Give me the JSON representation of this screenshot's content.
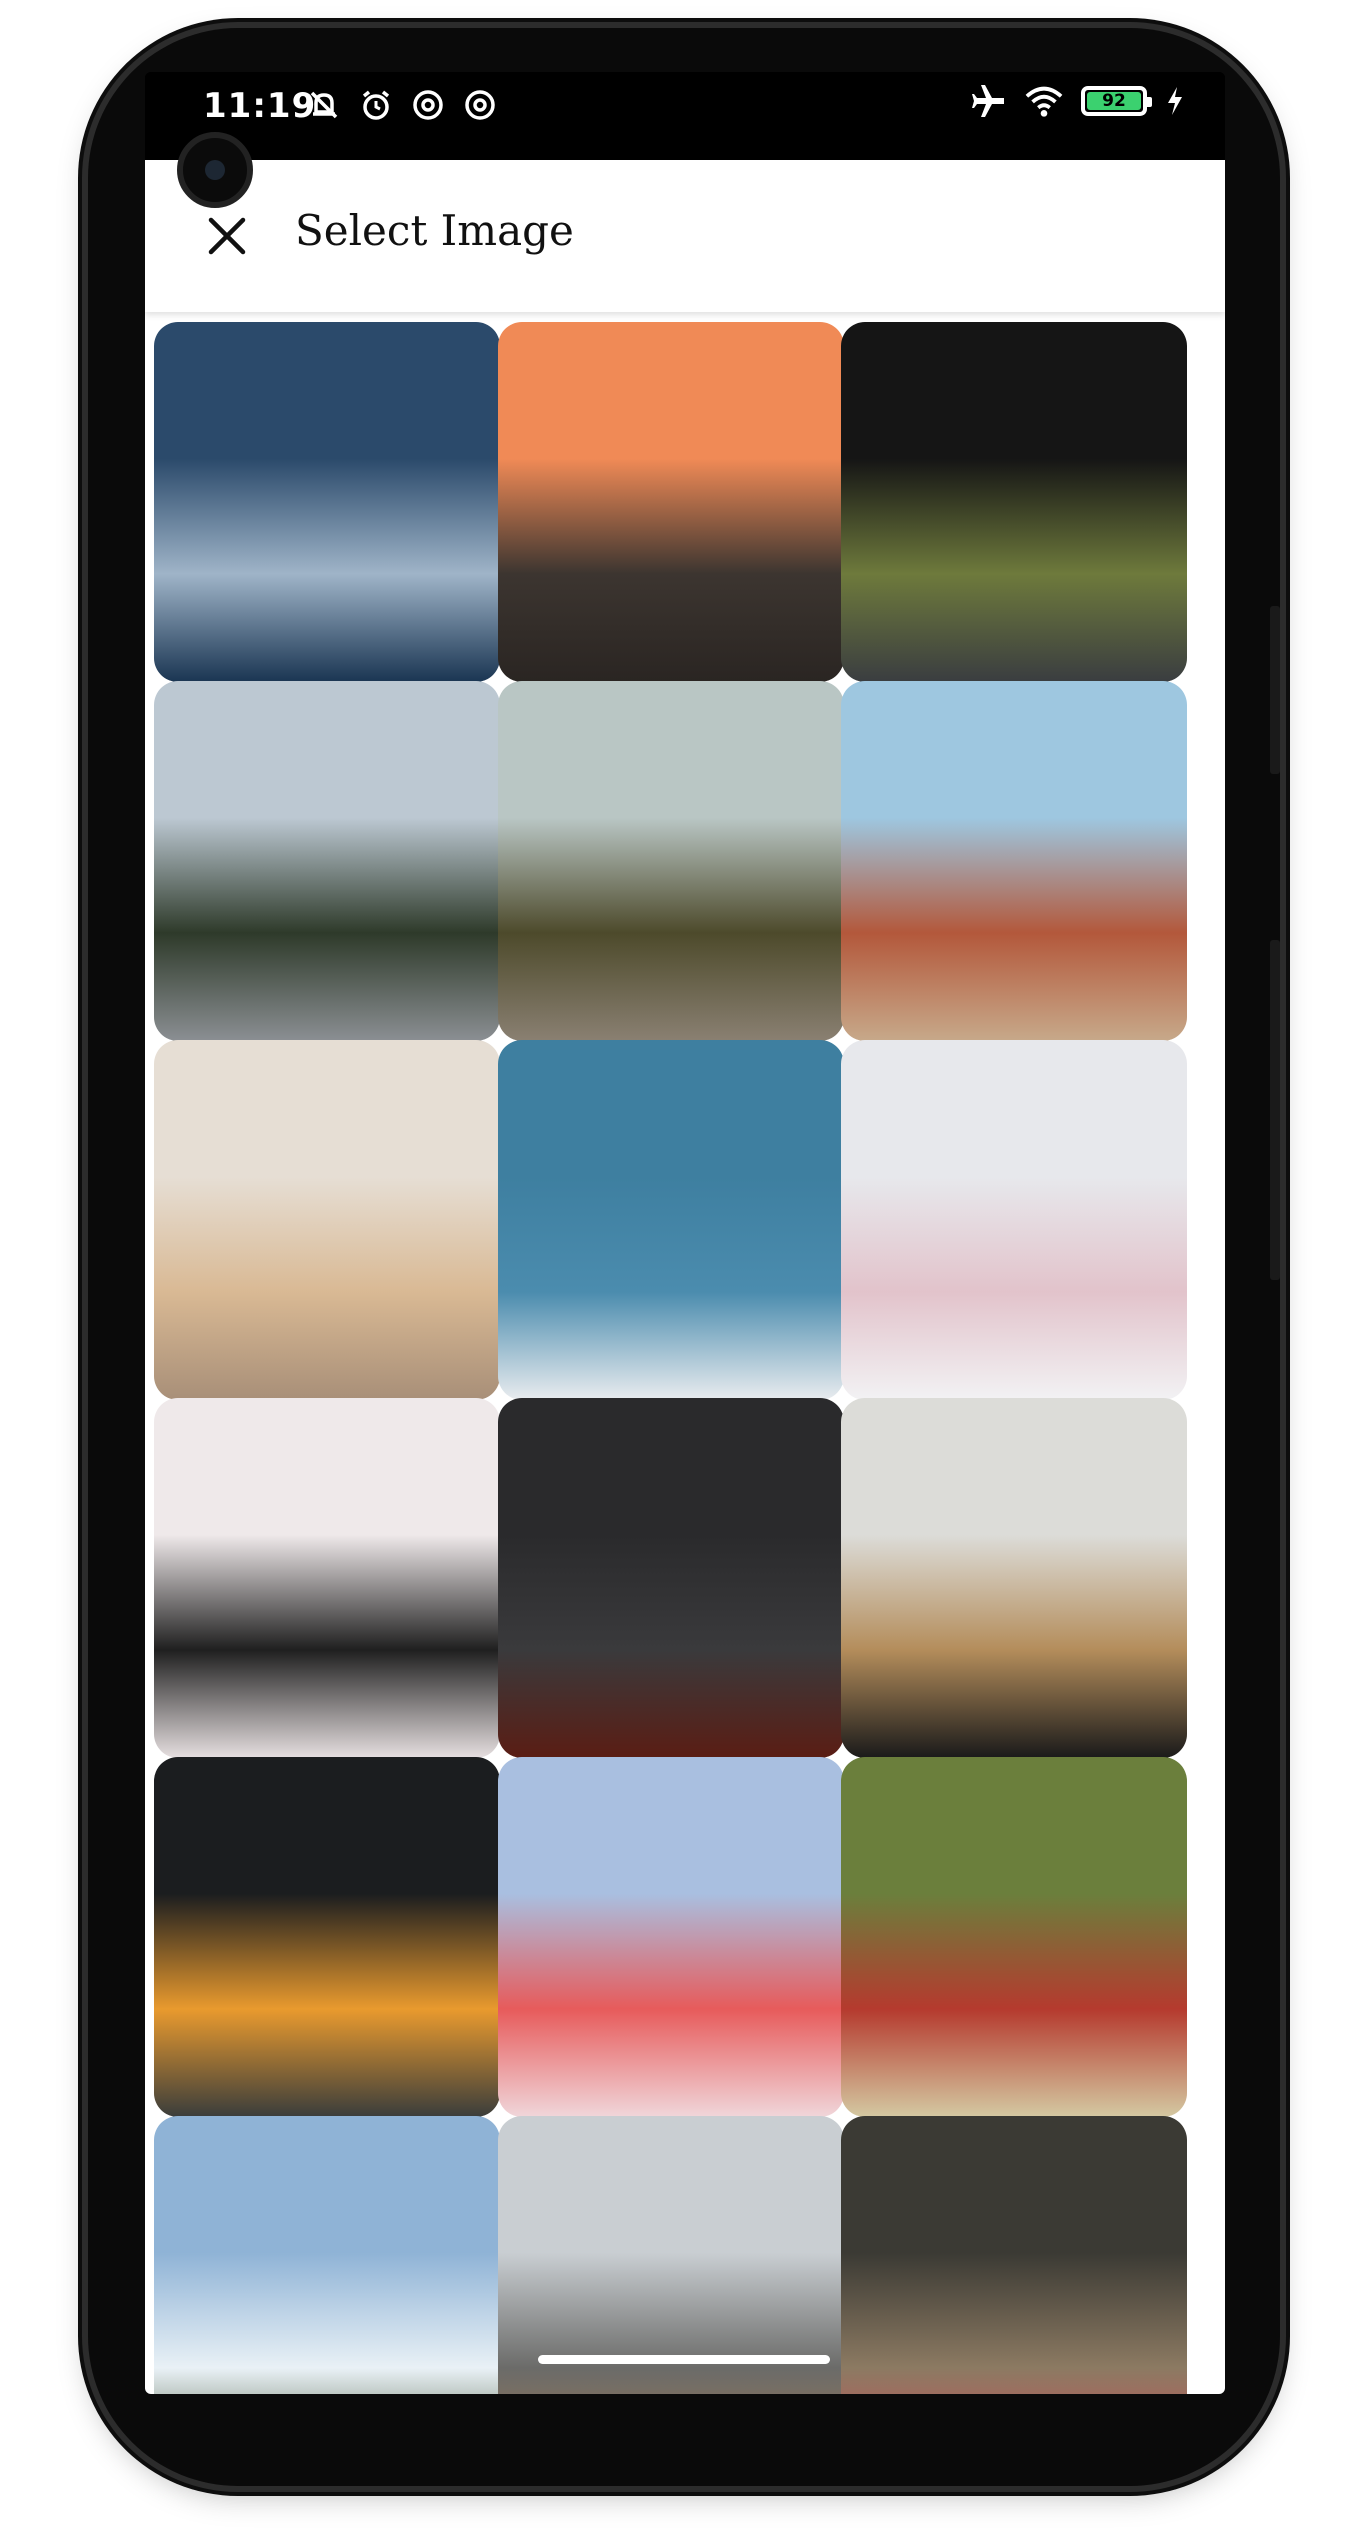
{
  "status_bar": {
    "time": "11:19",
    "left_icons": [
      "bell-off-icon",
      "alarm-icon",
      "sync-icon",
      "sync-icon"
    ],
    "right_icons": [
      "airplane-icon",
      "wifi-icon"
    ],
    "battery_percent": "92",
    "charging": true
  },
  "app_bar": {
    "title": "Select Image",
    "close_icon": "close-icon"
  },
  "grid": {
    "columns": 3,
    "images": [
      {
        "name": "image-ocean-waves",
        "colors": [
          "#2b4a6b",
          "#9fb4c8",
          "#1a3552"
        ]
      },
      {
        "name": "image-sunset-road",
        "colors": [
          "#f08a56",
          "#3c3530",
          "#2a2522"
        ]
      },
      {
        "name": "image-tunnel-road",
        "colors": [
          "#151515",
          "#6e7a3c",
          "#3a3d40"
        ]
      },
      {
        "name": "image-mountain-bridge",
        "colors": [
          "#bcc8d2",
          "#2e3a2a",
          "#8b8f93"
        ]
      },
      {
        "name": "image-pine-forest",
        "colors": [
          "#b9c6c4",
          "#4d4a2b",
          "#8a8072"
        ]
      },
      {
        "name": "image-desert-van",
        "colors": [
          "#9ec7e0",
          "#b3583b",
          "#c7a98a"
        ]
      },
      {
        "name": "image-camper-van",
        "colors": [
          "#e6ded4",
          "#d9b994",
          "#a88f78"
        ]
      },
      {
        "name": "image-motel-sign",
        "colors": [
          "#3e7fa0",
          "#4b8cae",
          "#e9ecef"
        ]
      },
      {
        "name": "image-polaroids",
        "colors": [
          "#e7e8ec",
          "#e2c3cb",
          "#f2f2f4"
        ]
      },
      {
        "name": "image-wall-frames",
        "colors": [
          "#efe9ea",
          "#1f1f1f",
          "#e6dfe0"
        ]
      },
      {
        "name": "image-brick-wall-frame",
        "colors": [
          "#2a2a2c",
          "#3a3a3c",
          "#5a1d14"
        ]
      },
      {
        "name": "image-cafe-woman",
        "colors": [
          "#dcdcd8",
          "#b48d5b",
          "#1a1a1a"
        ]
      },
      {
        "name": "image-pancakes",
        "colors": [
          "#1b1d1f",
          "#e99a2e",
          "#3a3d3b"
        ]
      },
      {
        "name": "image-smoothie-bowl",
        "colors": [
          "#a9bfe0",
          "#e75b5b",
          "#f0d6da"
        ]
      },
      {
        "name": "image-market-stall",
        "colors": [
          "#6b7f3c",
          "#b53a2e",
          "#d4c9a2"
        ]
      },
      {
        "name": "image-hilltop-pagoda",
        "colors": [
          "#8fb3d6",
          "#e9f1f6",
          "#3f4f2d"
        ]
      },
      {
        "name": "image-golden-bridge-hands",
        "colors": [
          "#c9ced2",
          "#6b6b69",
          "#a07a52"
        ]
      },
      {
        "name": "image-old-town-street",
        "colors": [
          "#3b3a34",
          "#8c7a62",
          "#d14a5a"
        ]
      }
    ]
  }
}
